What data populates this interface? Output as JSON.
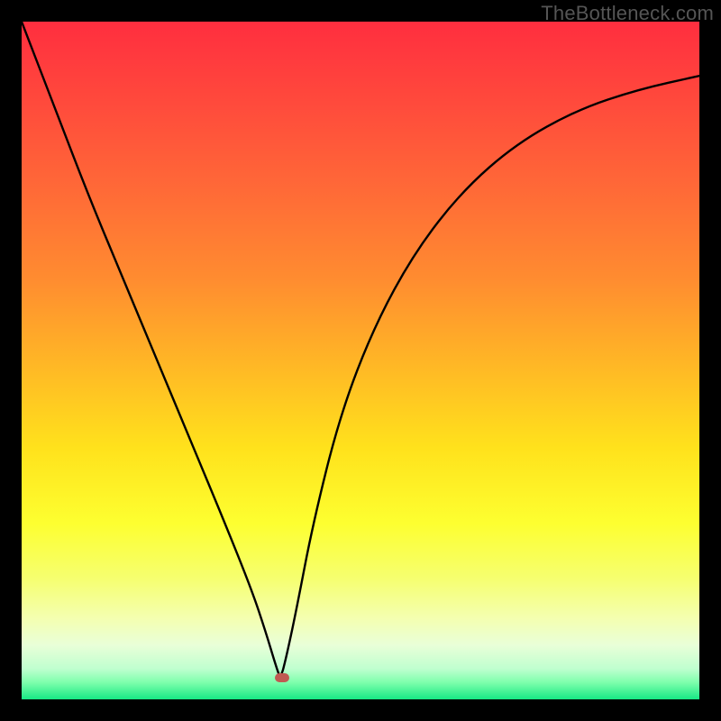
{
  "watermark": "TheBottleneck.com",
  "frame": {
    "inner_width": 752,
    "inner_height": 752
  },
  "gradient": {
    "stops": [
      {
        "offset": 0.0,
        "color": "#ff2e3f"
      },
      {
        "offset": 0.12,
        "color": "#ff4a3c"
      },
      {
        "offset": 0.25,
        "color": "#ff6a37"
      },
      {
        "offset": 0.38,
        "color": "#ff8c30"
      },
      {
        "offset": 0.5,
        "color": "#ffb526"
      },
      {
        "offset": 0.63,
        "color": "#ffe21c"
      },
      {
        "offset": 0.74,
        "color": "#fdff30"
      },
      {
        "offset": 0.82,
        "color": "#f6ff6e"
      },
      {
        "offset": 0.88,
        "color": "#f4ffb0"
      },
      {
        "offset": 0.92,
        "color": "#e9ffd8"
      },
      {
        "offset": 0.955,
        "color": "#bfffcf"
      },
      {
        "offset": 0.975,
        "color": "#7effac"
      },
      {
        "offset": 1.0,
        "color": "#17e884"
      }
    ]
  },
  "marker": {
    "x_frac": 0.384,
    "y_frac": 0.968,
    "color": "#c05a52"
  },
  "chart_data": {
    "type": "line",
    "title": "",
    "xlabel": "",
    "ylabel": "",
    "xlim": [
      0,
      1
    ],
    "ylim": [
      0,
      1
    ],
    "optimum_x": 0.382,
    "series": [
      {
        "name": "bottleneck-curve",
        "x": [
          0.0,
          0.05,
          0.1,
          0.15,
          0.2,
          0.25,
          0.3,
          0.34,
          0.36,
          0.375,
          0.382,
          0.39,
          0.405,
          0.43,
          0.47,
          0.52,
          0.58,
          0.65,
          0.73,
          0.82,
          0.91,
          1.0
        ],
        "y": [
          1.0,
          0.87,
          0.74,
          0.62,
          0.5,
          0.38,
          0.26,
          0.16,
          0.1,
          0.05,
          0.03,
          0.06,
          0.13,
          0.26,
          0.42,
          0.55,
          0.66,
          0.75,
          0.82,
          0.87,
          0.9,
          0.92
        ]
      }
    ],
    "background": "vertical-gradient-red-to-green"
  }
}
